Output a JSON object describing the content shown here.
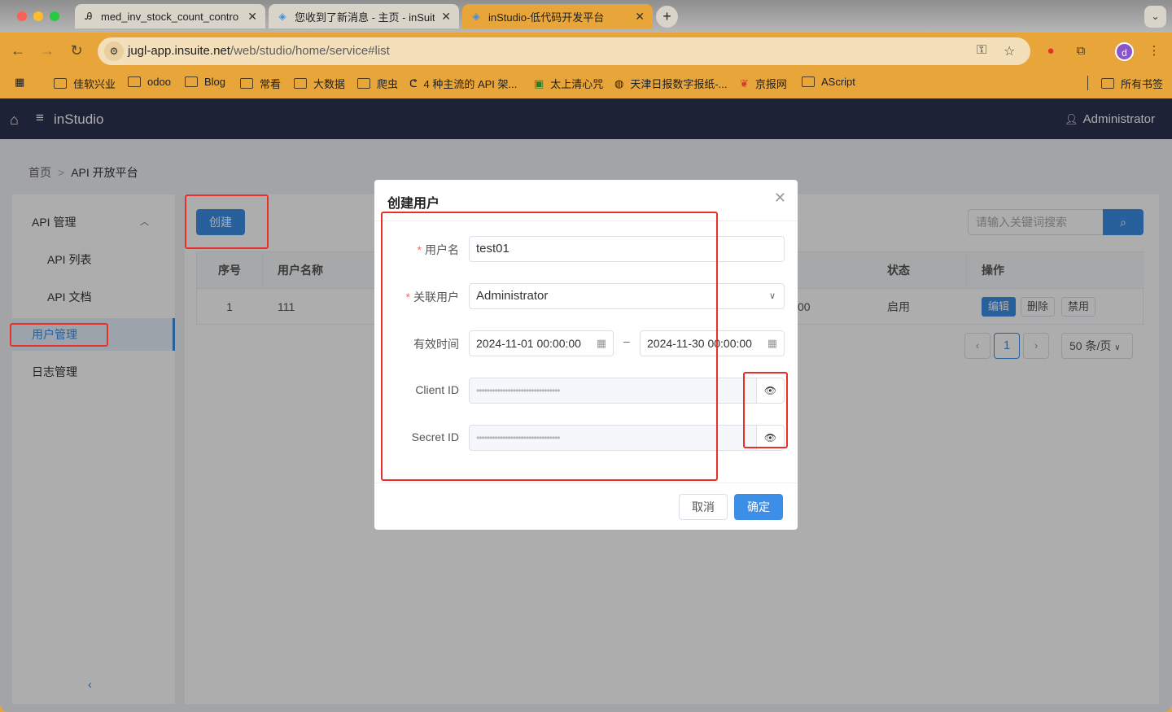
{
  "browser": {
    "tabs": [
      {
        "title": "med_inv_stock_count_contro",
        "icon": "ascript-icon"
      },
      {
        "title": "您收到了新消息 - 主页 - inSuit",
        "icon": "insuite-icon"
      },
      {
        "title": "inStudio-低代码开发平台",
        "icon": "insuite-icon",
        "active": true
      }
    ],
    "url_host": "jugl-app.insuite.net",
    "url_path": "/web/studio/home/service#list",
    "avatar_letter": "d",
    "bookmarks": [
      "佳软兴业",
      "odoo",
      "Blog",
      "常看",
      "大数据",
      "爬虫",
      "4 种主流的 API 架...",
      "太上清心咒",
      "天津日报数字报纸-...",
      "京报网",
      "AScript"
    ],
    "all_bookmarks": "所有书签",
    "theme_color": "#e7a53a"
  },
  "header": {
    "app_name": "inStudio",
    "user": "Administrator",
    "bg_color": "#2b3352"
  },
  "breadcrumb": [
    "首页",
    "API 开放平台"
  ],
  "sidebar": {
    "groups": [
      {
        "label": "API 管理",
        "expanded": true,
        "items": [
          "API 列表",
          "API 文档"
        ]
      }
    ],
    "items": [
      "用户管理",
      "日志管理"
    ],
    "active": "用户管理"
  },
  "toolbar": {
    "create_label": "创建",
    "search_placeholder": "请输入关键词搜索"
  },
  "table": {
    "columns": [
      "序号",
      "用户名称",
      "状态",
      "操作"
    ],
    "rows": [
      {
        "index": "1",
        "name": "111",
        "partial": "00",
        "status": "启用",
        "actions": [
          "编辑",
          "删除",
          "禁用"
        ]
      }
    ]
  },
  "pagination": {
    "prev": "‹",
    "current": "1",
    "next": "›",
    "page_size": "50 条/页"
  },
  "modal": {
    "title": "创建用户",
    "fields": {
      "username": {
        "label": "用户名",
        "required": true,
        "value": "test01"
      },
      "linked_user": {
        "label": "关联用户",
        "required": true,
        "value": "Administrator"
      },
      "valid_time": {
        "label": "有效时间",
        "start": "2024-11-01 00:00:00",
        "end": "2024-11-30 00:00:00",
        "separator": "–"
      },
      "client_id": {
        "label": "Client ID",
        "value": "••••••••••••••••••••••••••••••••"
      },
      "secret_id": {
        "label": "Secret ID",
        "value": "••••••••••••••••••••••••••••••••"
      }
    },
    "cancel_label": "取消",
    "ok_label": "确定"
  },
  "accent_color": "#3c8ee6",
  "annotation_color": "#e8302a"
}
